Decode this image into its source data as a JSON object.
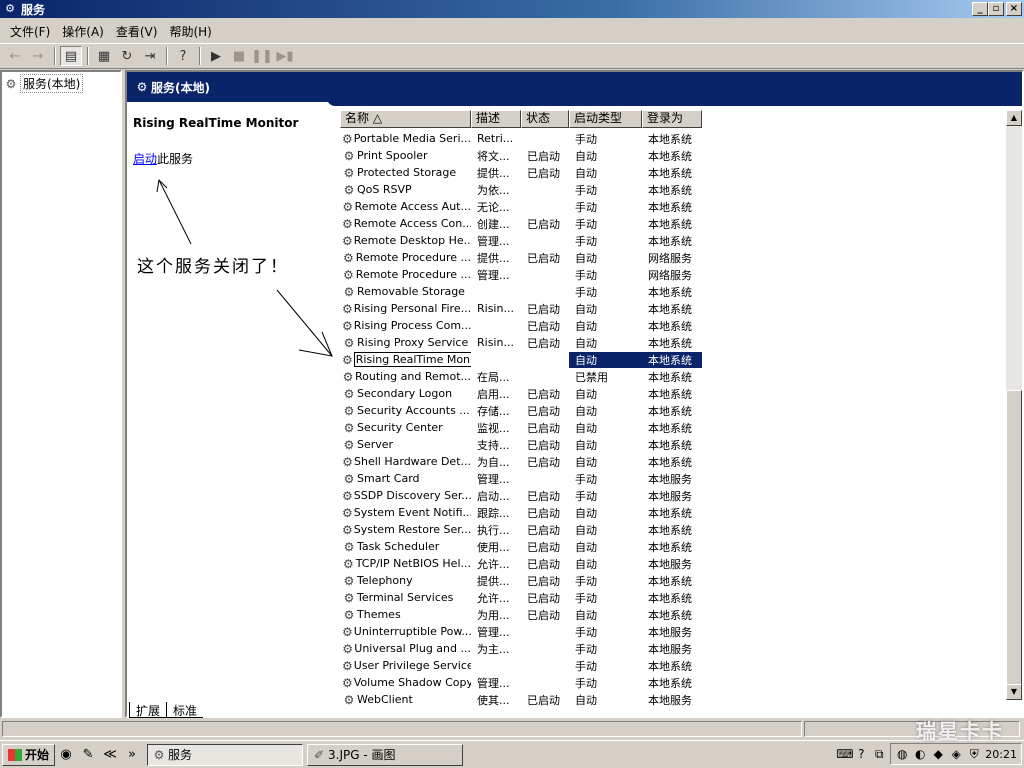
{
  "window": {
    "title": "服务",
    "btn_min": "_",
    "btn_max": "▫",
    "btn_close": "×"
  },
  "menu": [
    {
      "label": "文件(F)"
    },
    {
      "label": "操作(A)"
    },
    {
      "label": "查看(V)"
    },
    {
      "label": "帮助(H)"
    }
  ],
  "toolbar": {
    "back_icon": "←",
    "forward_icon": "→",
    "tree_icon": "▤",
    "props_icon": "▦",
    "refresh_icon": "↻",
    "export_icon": "⇥",
    "help_icon": "?",
    "play_icon": "▶",
    "stop_icon": "■",
    "pause_icon": "❚❚",
    "restart_icon": "▶▮"
  },
  "tree": {
    "root_label": "服务(本地)"
  },
  "main": {
    "header_title": "服务(本地)",
    "selected_name": "Rising RealTime Monitor",
    "action_link": "启动",
    "action_suffix": "此服务",
    "annotation": "这个服务关闭了！"
  },
  "columns": [
    {
      "label": "名称 △",
      "width": 131
    },
    {
      "label": "描述",
      "width": 50
    },
    {
      "label": "状态",
      "width": 48
    },
    {
      "label": "启动类型",
      "width": 73
    },
    {
      "label": "登录为",
      "width": 60
    }
  ],
  "services": [
    {
      "name": "Portable Media Seri...",
      "desc": "Retri...",
      "status": "",
      "start": "手动",
      "logon": "本地系统"
    },
    {
      "name": "Print Spooler",
      "desc": "将文...",
      "status": "已启动",
      "start": "自动",
      "logon": "本地系统"
    },
    {
      "name": "Protected Storage",
      "desc": "提供...",
      "status": "已启动",
      "start": "自动",
      "logon": "本地系统"
    },
    {
      "name": "QoS RSVP",
      "desc": "为依...",
      "status": "",
      "start": "手动",
      "logon": "本地系统"
    },
    {
      "name": "Remote Access Aut...",
      "desc": "无论...",
      "status": "",
      "start": "手动",
      "logon": "本地系统"
    },
    {
      "name": "Remote Access Con...",
      "desc": "创建...",
      "status": "已启动",
      "start": "手动",
      "logon": "本地系统"
    },
    {
      "name": "Remote Desktop He...",
      "desc": "管理...",
      "status": "",
      "start": "手动",
      "logon": "本地系统"
    },
    {
      "name": "Remote Procedure ...",
      "desc": "提供...",
      "status": "已启动",
      "start": "自动",
      "logon": "网络服务"
    },
    {
      "name": "Remote Procedure ...",
      "desc": "管理...",
      "status": "",
      "start": "手动",
      "logon": "网络服务"
    },
    {
      "name": "Removable Storage",
      "desc": "",
      "status": "",
      "start": "手动",
      "logon": "本地系统"
    },
    {
      "name": "Rising Personal Fire...",
      "desc": "Risin...",
      "status": "已启动",
      "start": "自动",
      "logon": "本地系统"
    },
    {
      "name": "Rising Process Com...",
      "desc": "",
      "status": "已启动",
      "start": "自动",
      "logon": "本地系统"
    },
    {
      "name": "Rising Proxy  Service",
      "desc": "Risin...",
      "status": "已启动",
      "start": "自动",
      "logon": "本地系统"
    },
    {
      "name": "Rising RealTime Monitor",
      "desc": "",
      "status": "",
      "start": "自动",
      "logon": "本地系统",
      "selected": true
    },
    {
      "name": "Routing and Remot...",
      "desc": "在局...",
      "status": "",
      "start": "已禁用",
      "logon": "本地系统"
    },
    {
      "name": "Secondary Logon",
      "desc": "启用...",
      "status": "已启动",
      "start": "自动",
      "logon": "本地系统"
    },
    {
      "name": "Security Accounts ...",
      "desc": "存储...",
      "status": "已启动",
      "start": "自动",
      "logon": "本地系统"
    },
    {
      "name": "Security Center",
      "desc": "监视...",
      "status": "已启动",
      "start": "自动",
      "logon": "本地系统"
    },
    {
      "name": "Server",
      "desc": "支持...",
      "status": "已启动",
      "start": "自动",
      "logon": "本地系统"
    },
    {
      "name": "Shell Hardware Det...",
      "desc": "为自...",
      "status": "已启动",
      "start": "自动",
      "logon": "本地系统"
    },
    {
      "name": "Smart Card",
      "desc": "管理...",
      "status": "",
      "start": "手动",
      "logon": "本地服务"
    },
    {
      "name": "SSDP Discovery Ser...",
      "desc": "启动...",
      "status": "已启动",
      "start": "手动",
      "logon": "本地服务"
    },
    {
      "name": "System Event Notifi...",
      "desc": "跟踪...",
      "status": "已启动",
      "start": "自动",
      "logon": "本地系统"
    },
    {
      "name": "System Restore Ser...",
      "desc": "执行...",
      "status": "已启动",
      "start": "自动",
      "logon": "本地系统"
    },
    {
      "name": "Task Scheduler",
      "desc": "使用...",
      "status": "已启动",
      "start": "自动",
      "logon": "本地系统"
    },
    {
      "name": "TCP/IP NetBIOS Hel...",
      "desc": "允许...",
      "status": "已启动",
      "start": "自动",
      "logon": "本地服务"
    },
    {
      "name": "Telephony",
      "desc": "提供...",
      "status": "已启动",
      "start": "手动",
      "logon": "本地系统"
    },
    {
      "name": "Terminal Services",
      "desc": "允许...",
      "status": "已启动",
      "start": "手动",
      "logon": "本地系统"
    },
    {
      "name": "Themes",
      "desc": "为用...",
      "status": "已启动",
      "start": "自动",
      "logon": "本地系统"
    },
    {
      "name": "Uninterruptible Pow...",
      "desc": "管理...",
      "status": "",
      "start": "手动",
      "logon": "本地服务"
    },
    {
      "name": "Universal Plug and ...",
      "desc": "为主...",
      "status": "",
      "start": "手动",
      "logon": "本地服务"
    },
    {
      "name": "User Privilege Service",
      "desc": "",
      "status": "",
      "start": "手动",
      "logon": "本地系统"
    },
    {
      "name": "Volume Shadow Copy",
      "desc": "管理...",
      "status": "",
      "start": "手动",
      "logon": "本地系统"
    },
    {
      "name": "WebClient",
      "desc": "使其...",
      "status": "已启动",
      "start": "自动",
      "logon": "本地服务"
    }
  ],
  "tabs": [
    {
      "label": "扩展",
      "active": true
    },
    {
      "label": "标准",
      "active": false
    }
  ],
  "taskbar": {
    "start_label": "开始",
    "ql_more": "»",
    "tasks": [
      {
        "label": "服务",
        "active": true
      },
      {
        "label": "3.JPG - 画图",
        "active": false
      }
    ],
    "clock": "20:21",
    "watermark": "瑞星卡卡"
  }
}
